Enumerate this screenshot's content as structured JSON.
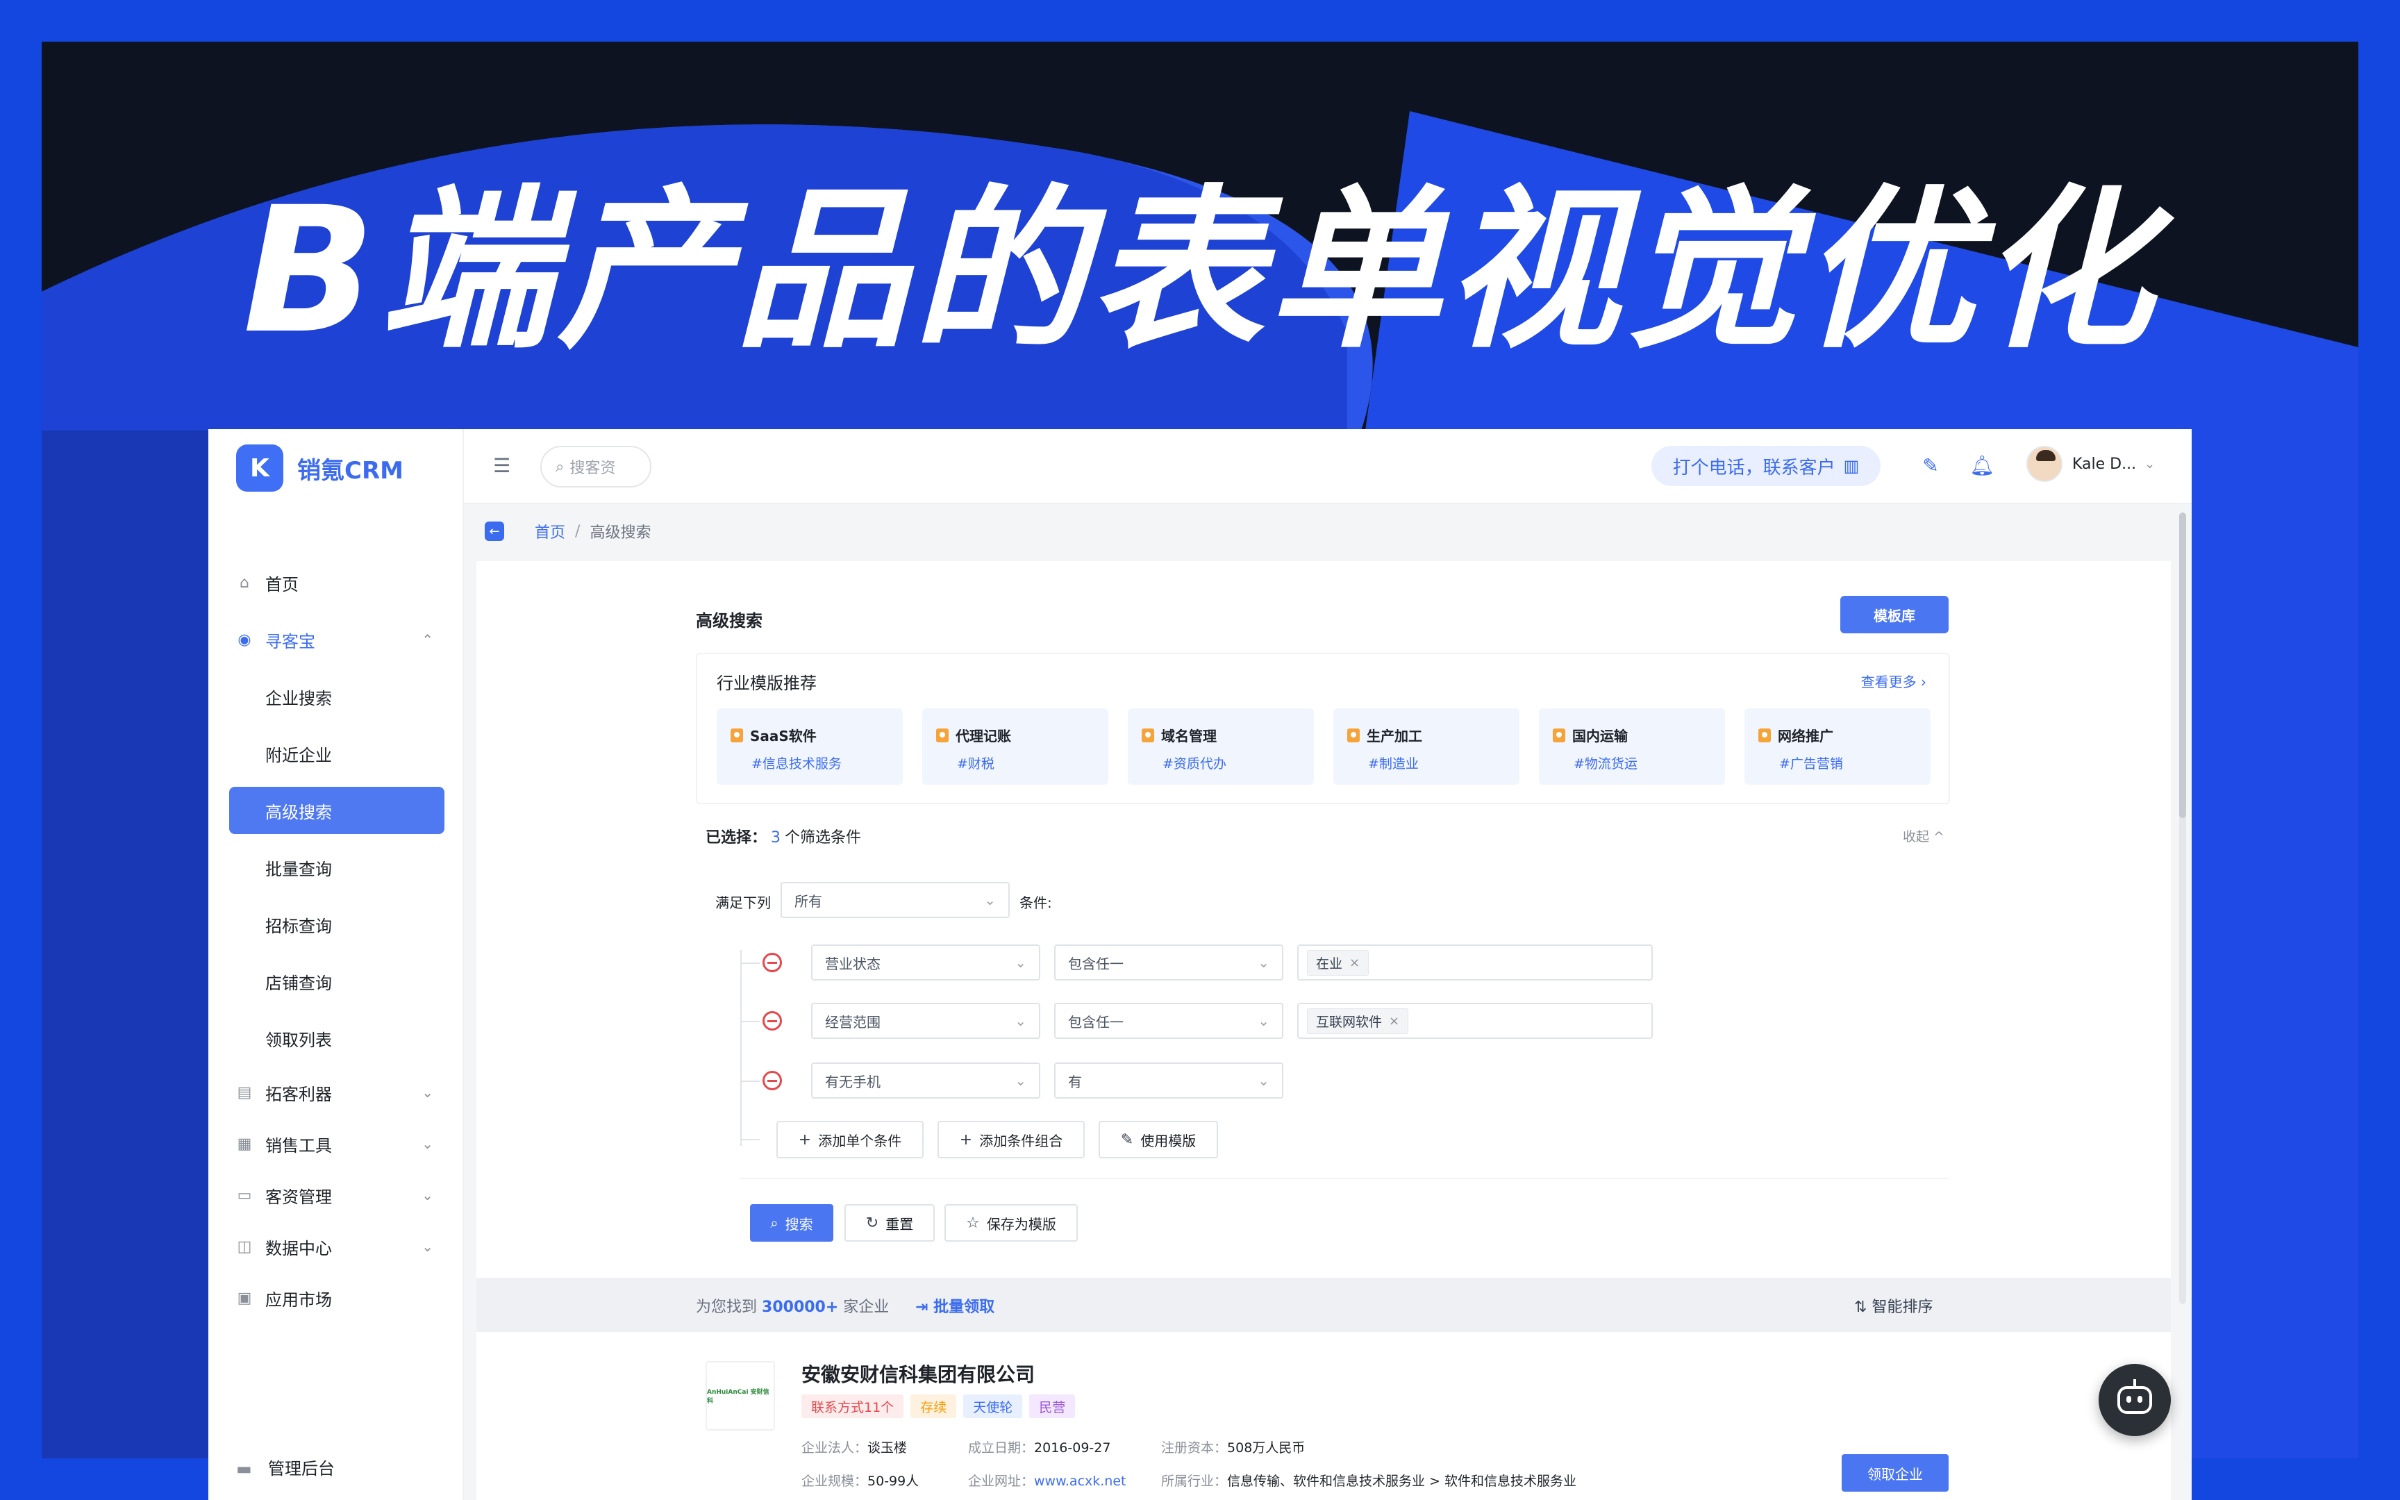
{
  "poster": {
    "title": "B端产品的表单视觉优化",
    "colors": {
      "frame": "#1446e0",
      "dark": "#0d1320",
      "accent": "#2c55ea"
    }
  },
  "app": {
    "logo": {
      "badge": "K",
      "name": "销氪CRM"
    },
    "sidebar": {
      "items": [
        {
          "label": "首页",
          "icon": "home-icon"
        },
        {
          "label": "寻客宝",
          "icon": "compass-icon",
          "expanded": true
        },
        {
          "label": "拓客利器",
          "icon": "id-card-icon"
        },
        {
          "label": "销售工具",
          "icon": "grid-icon"
        },
        {
          "label": "客资管理",
          "icon": "crm-icon"
        },
        {
          "label": "数据中心",
          "icon": "chart-icon"
        },
        {
          "label": "应用市场",
          "icon": "store-icon"
        }
      ],
      "sub_items": [
        "企业搜索",
        "附近企业",
        "高级搜索",
        "批量查询",
        "招标查询",
        "店铺查询",
        "领取列表"
      ],
      "active_sub": "高级搜索",
      "footer": "管理后台"
    },
    "topbar": {
      "search_placeholder": "搜客资",
      "call_label": "打个电话，联系客户",
      "user_name": "Kale D..."
    },
    "breadcrumb": {
      "home": "首页",
      "sep": "/",
      "current": "高级搜索"
    },
    "panel": {
      "title": "高级搜索",
      "template_lib": "模板库",
      "industry": {
        "title": "行业模版推荐",
        "more": "查看更多 ›",
        "cards": [
          {
            "name": "SaaS软件",
            "tag": "#信息技术服务"
          },
          {
            "name": "代理记账",
            "tag": "#财税"
          },
          {
            "name": "域名管理",
            "tag": "#资质代办"
          },
          {
            "name": "生产加工",
            "tag": "#制造业"
          },
          {
            "name": "国内运输",
            "tag": "#物流货运"
          },
          {
            "name": "网络推广",
            "tag": "#广告营销"
          }
        ]
      },
      "selected": {
        "label": "已选择：",
        "count": "3",
        "suffix": "个筛选条件",
        "collapse": "收起 ^"
      },
      "match": {
        "prefix": "满足下列",
        "value": "所有",
        "suffix": "条件:"
      },
      "conditions": [
        {
          "field": "营业状态",
          "op": "包含任一",
          "value": "在业"
        },
        {
          "field": "经营范围",
          "op": "包含任一",
          "value": "互联网软件"
        },
        {
          "field": "有无手机",
          "op": "有",
          "value": ""
        }
      ],
      "add_buttons": [
        "添加单个条件",
        "添加条件组合",
        "使用模版"
      ],
      "actions": {
        "search": "搜索",
        "reset": "重置",
        "save": "保存为模版"
      }
    },
    "results": {
      "prefix": "为您找到",
      "count": "300000+",
      "suffix": "家企业",
      "batch": "批量领取",
      "sort": "智能排序"
    },
    "company": {
      "logo_text": "AnHuiAnCai 安财信科",
      "name": "安徽安财信科集团有限公司",
      "tags": [
        {
          "label": "联系方式11个",
          "bg": "#fdecec",
          "fg": "#e5484d"
        },
        {
          "label": "存续",
          "bg": "#fff1df",
          "fg": "#f59e0b"
        },
        {
          "label": "天使轮",
          "bg": "#e8efff",
          "fg": "#3b6cf0"
        },
        {
          "label": "民营",
          "bg": "#f3e8ff",
          "fg": "#9b59d6"
        }
      ],
      "legal_label": "企业法人：",
      "legal": "谈玉楼",
      "founded_label": "成立日期：",
      "founded": "2016-09-27",
      "capital_label": "注册资本：",
      "capital": "508万人民币",
      "scale_label": "企业规模：",
      "scale": "50-99人",
      "site_label": "企业网址：",
      "site": "www.acxk.net",
      "industry_label": "所属行业：",
      "industry": "信息传输、软件和信息技术服务业 > 软件和信息技术服务业",
      "claim": "领取企业"
    }
  }
}
